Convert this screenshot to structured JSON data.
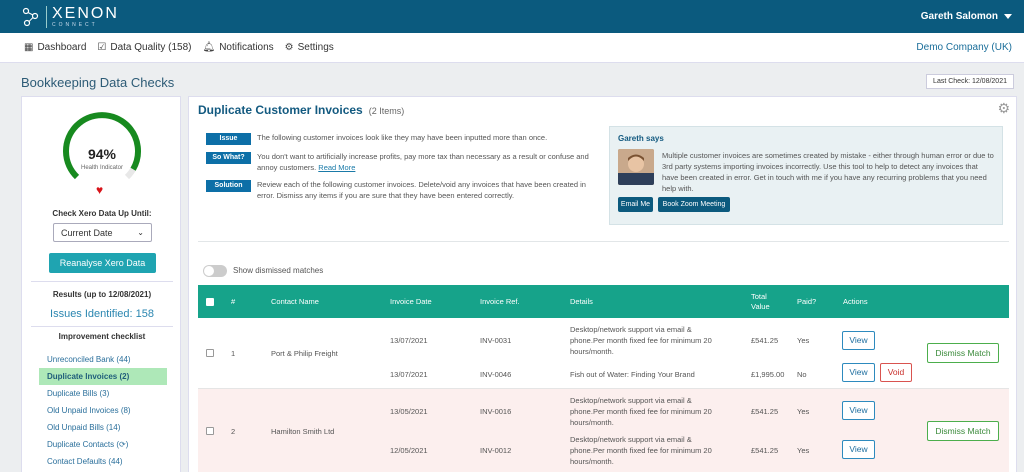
{
  "app": {
    "logo_name": "XENON",
    "logo_sub": "CONNECT",
    "user_name": "Gareth Salomon"
  },
  "nav": {
    "items": [
      {
        "label": "Dashboard",
        "icon": "grid-icon"
      },
      {
        "label": "Data Quality (158)",
        "icon": "checkbox-icon"
      },
      {
        "label": "Notifications",
        "icon": "bell-icon"
      },
      {
        "label": "Settings",
        "icon": "gear-icon"
      }
    ],
    "company": "Demo Company (UK)"
  },
  "page": {
    "title": "Bookkeeping Data Checks",
    "last_check": "Last Check: 12/08/2021"
  },
  "health": {
    "percent_text": "94%",
    "value": 0.94,
    "label": "Health Indicator",
    "check_label": "Check Xero Data Up Until:",
    "date_option": "Current Date",
    "reanalyse": "Reanalyse Xero Data",
    "results_label": "Results (up to 12/08/2021)",
    "issues": "Issues Identified: 158",
    "checklist_title": "Improvement checklist"
  },
  "checklist": [
    {
      "label": "Unreconciled Bank (44)",
      "active": false
    },
    {
      "label": "Duplicate Invoices (2)",
      "active": true
    },
    {
      "label": "Duplicate Bills (3)",
      "active": false
    },
    {
      "label": "Old Unpaid Invoices (8)",
      "active": false
    },
    {
      "label": "Old Unpaid Bills (14)",
      "active": false
    },
    {
      "label": "Duplicate Contacts (⟳)",
      "active": false
    },
    {
      "label": "Contact Defaults (44)",
      "active": false
    }
  ],
  "main": {
    "title": "Duplicate Customer Invoices",
    "count": "(2 Items)",
    "issue_tag": "Issue",
    "issue_text": "The following customer invoices look like they may have been inputted more than once.",
    "sowhat_tag": "So What?",
    "sowhat_text": "You don't want to artificially increase profits, pay more tax than necessary as a result or confuse and annoy customers.",
    "read_more": "Read More",
    "solution_tag": "Solution",
    "solution_text": "Review each of the following customer invoices. Delete/void any invoices that have been created in error. Dismiss any items if you are sure that they have been entered correctly.",
    "gareth_title": "Gareth says",
    "gareth_text": "Multiple customer invoices are sometimes created by mistake - either through human error or due to 3rd party systems importing invoices incorrectly. Use this tool to help to detect any invoices that have been created in error. Get in touch with me if you have any recurring problems that you need help with.",
    "email_btn": "Email Me",
    "zoom_btn": "Book Zoom Meeting",
    "toggle_label": "Show dismissed matches"
  },
  "table": {
    "headers": {
      "num": "#",
      "contact": "Contact Name",
      "date": "Invoice Date",
      "ref": "Invoice Ref.",
      "details": "Details",
      "total": "Total Value",
      "paid": "Paid?",
      "actions": "Actions"
    },
    "view_label": "View",
    "void_label": "Void",
    "dismiss_label": "Dismiss Match",
    "groups": [
      {
        "num": "1",
        "contact": "Port & Philip Freight",
        "rows": [
          {
            "date": "13/07/2021",
            "ref": "INV-0031",
            "details": "Desktop/network support via email & phone.Per month fixed fee for minimum 20 hours/month.",
            "total": "£541.25",
            "paid": "Yes"
          },
          {
            "date": "13/07/2021",
            "ref": "INV-0046",
            "details": "Fish out of Water: Finding Your Brand",
            "total": "£1,995.00",
            "paid": "No"
          }
        ]
      },
      {
        "num": "2",
        "contact": "Hamilton Smith Ltd",
        "rows": [
          {
            "date": "13/05/2021",
            "ref": "INV-0016",
            "details": "Desktop/network support via email & phone.Per month fixed fee for minimum 20 hours/month.",
            "total": "£541.25",
            "paid": "Yes"
          },
          {
            "date": "12/05/2021",
            "ref": "INV-0012",
            "details": "Desktop/network support via email & phone.Per month fixed fee for minimum 20 hours/month.",
            "total": "£541.25",
            "paid": "Yes"
          }
        ]
      }
    ]
  }
}
